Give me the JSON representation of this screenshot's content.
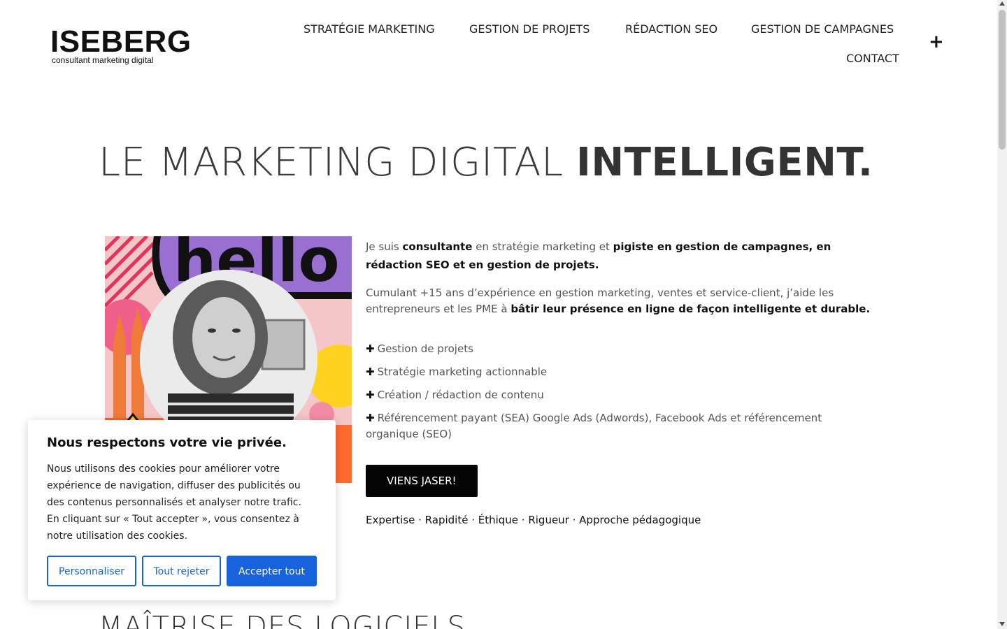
{
  "header": {
    "logo_main": "ISEBERG",
    "logo_sub": "consultant marketing digital",
    "nav": [
      {
        "label": "STRATÉGIE MARKETING"
      },
      {
        "label": "GESTION DE PROJETS"
      },
      {
        "label": "RÉDACTION SEO"
      },
      {
        "label": "GESTION DE CAMPAGNES"
      },
      {
        "label": "CONTACT"
      }
    ],
    "menu_toggle": "+"
  },
  "hero": {
    "headline_light": "LE MARKETING DIGITAL ",
    "headline_bold": "INTELLIGENT.",
    "image_text": "hello",
    "intro": {
      "t1": "Je suis ",
      "b1": "consultante",
      "t2": " en stratégie marketing et ",
      "b2": "pigiste en gestion de campagnes, en rédaction SEO et en gestion de projets."
    },
    "para2": {
      "t1": "Cumulant +15 ans d’expérience en gestion marketing, ventes et service-client, j’aide les entrepreneurs et les PME à ",
      "b1": "bâtir leur présence en ligne de façon intelligente et durable."
    },
    "list_bullet": "✚",
    "services": [
      "Gestion de projets",
      "Stratégie marketing actionnable",
      "Création / rédaction de contenu",
      "Référencement payant (SEA) Google Ads (Adwords), Facebook Ads et référencement organique (SEO)"
    ],
    "cta_label": "VIENS JASER!",
    "values": "Expertise · Rapidité · Éthique · Rigueur · Approche pédagogique"
  },
  "next_section_title": "MAÎTRISE DES LOGICIELS",
  "cookie_banner": {
    "title": "Nous respectons votre vie privée.",
    "body": "Nous utilisons des cookies pour améliorer votre expérience de navigation, diffuser des publicités ou des contenus personnalisés et analyser notre trafic. En cliquant sur « Tout accepter », vous consentez à notre utilisation des cookies.",
    "customize_label": "Personnaliser",
    "reject_label": "Tout rejeter",
    "accept_label": "Accepter tout",
    "accent_color": "#1863dc"
  }
}
